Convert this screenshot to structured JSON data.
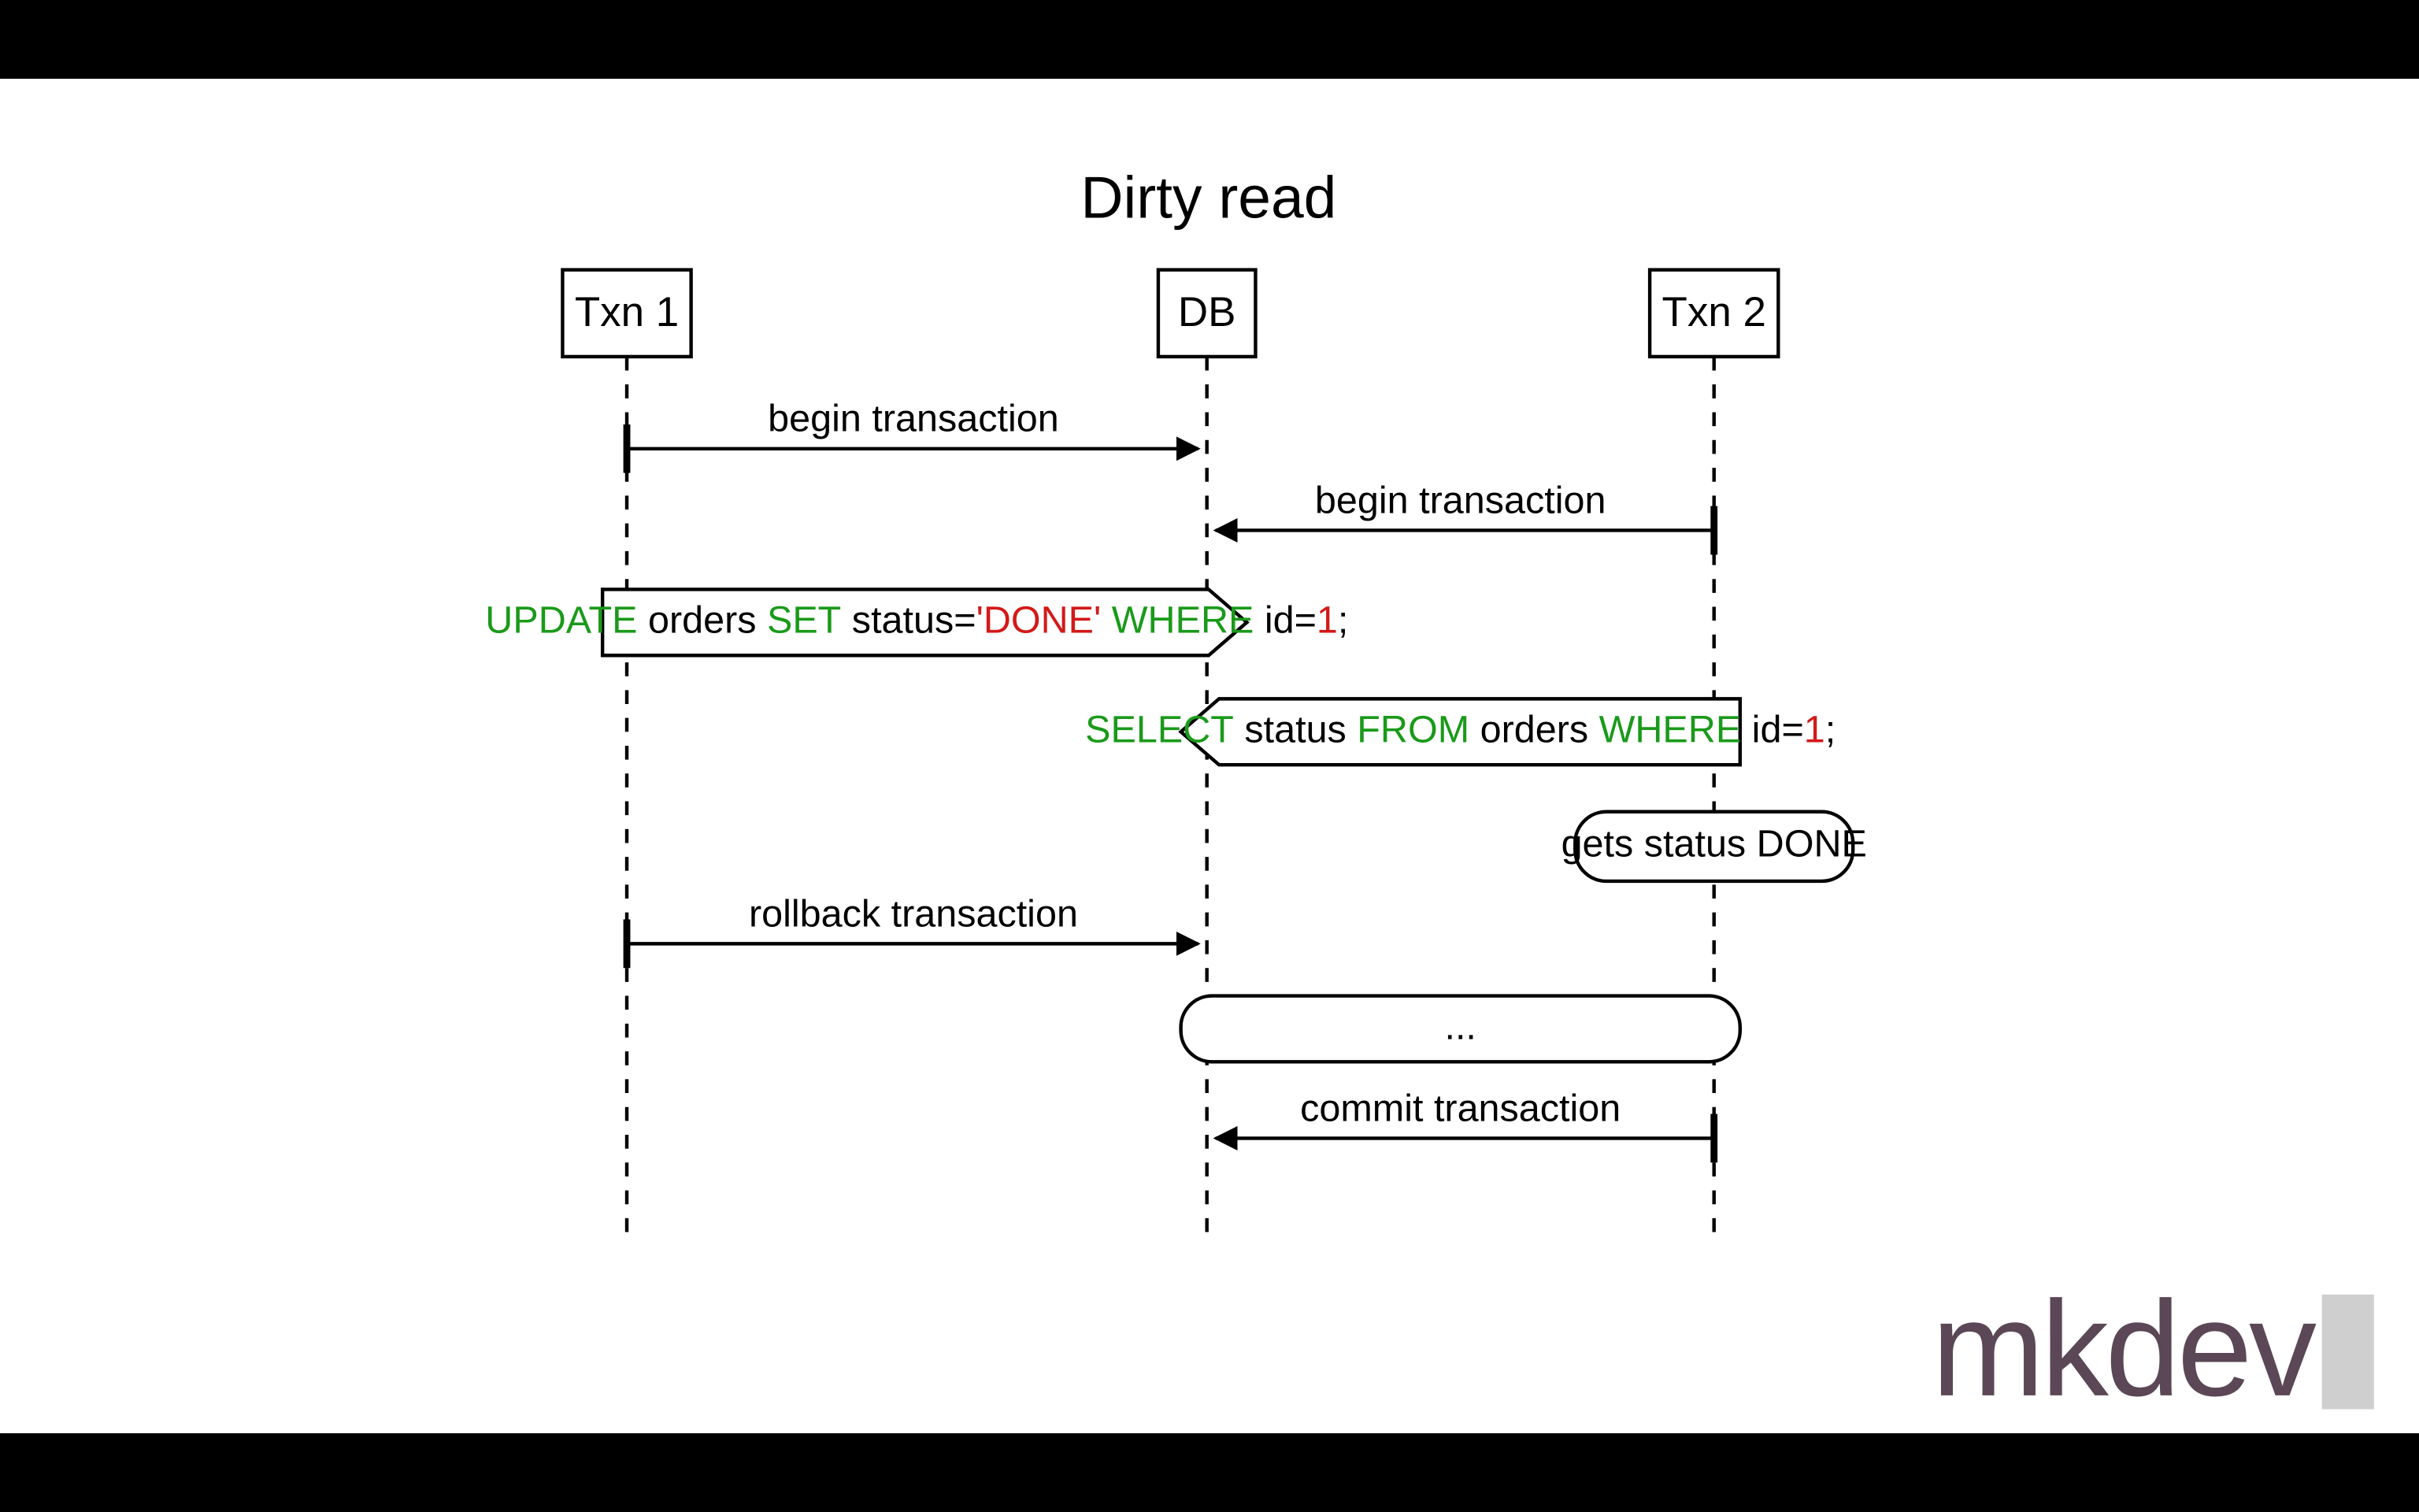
{
  "diagram": {
    "title": "Dirty read",
    "participants": {
      "txn1": "Txn 1",
      "db": "DB",
      "txn2": "Txn 2"
    },
    "messages": {
      "begin1": "begin transaction",
      "begin2": "begin transaction",
      "rollback": "rollback transaction",
      "commit": "commit transaction"
    },
    "sql": {
      "update": {
        "tokens": [
          {
            "t": "UPDATE",
            "c": "green"
          },
          {
            "t": " orders ",
            "c": "black"
          },
          {
            "t": "SET",
            "c": "green"
          },
          {
            "t": " status=",
            "c": "black"
          },
          {
            "t": "'DONE'",
            "c": "red"
          },
          {
            "t": " ",
            "c": "black"
          },
          {
            "t": "WHERE",
            "c": "green"
          },
          {
            "t": " id=",
            "c": "black"
          },
          {
            "t": "1",
            "c": "red"
          },
          {
            "t": ";",
            "c": "black"
          }
        ]
      },
      "select": {
        "tokens": [
          {
            "t": "SELECT",
            "c": "green"
          },
          {
            "t": " status ",
            "c": "black"
          },
          {
            "t": "FROM",
            "c": "green"
          },
          {
            "t": " orders ",
            "c": "black"
          },
          {
            "t": "WHERE",
            "c": "green"
          },
          {
            "t": " id=",
            "c": "black"
          },
          {
            "t": "1",
            "c": "red"
          },
          {
            "t": ";",
            "c": "black"
          }
        ]
      }
    },
    "notes": {
      "result": "gets status DONE",
      "ellipsis": "..."
    }
  },
  "brand": {
    "text": "mkdev"
  }
}
